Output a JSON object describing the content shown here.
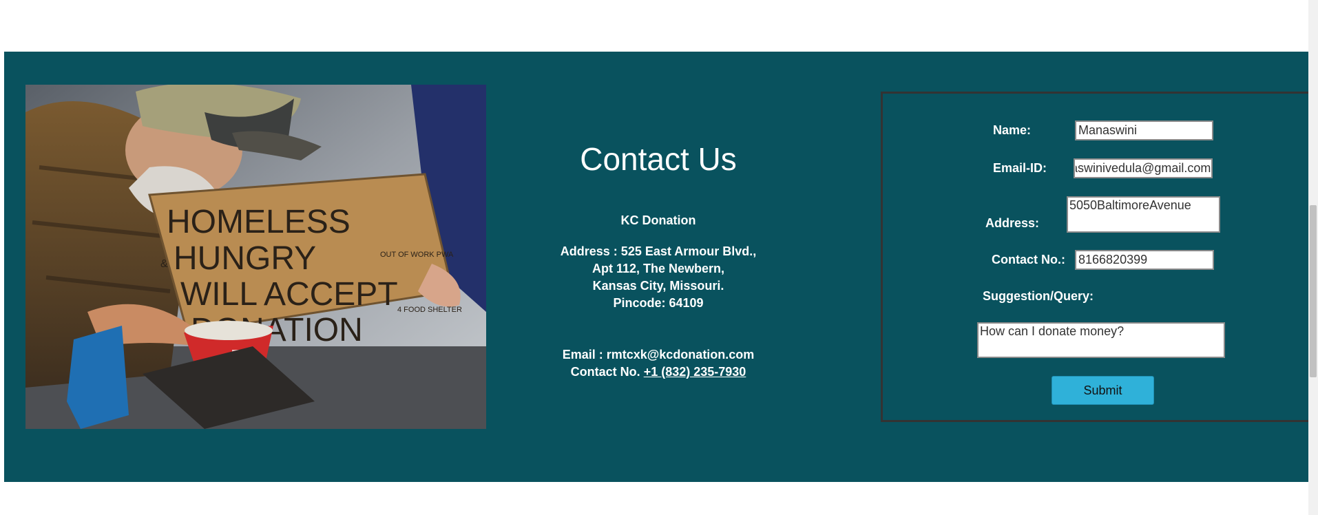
{
  "photo": {
    "alt": "Homeless man holding a cardboard sign asking for donations",
    "sign_lines": [
      "HOMELESS",
      "HUNGRY",
      "WILL ACCEPT",
      "DONATION"
    ],
    "sign_small_1": "OUT OF WORK PWA",
    "sign_small_2": "4 FOOD SHELTER",
    "sign_and": "&"
  },
  "contact": {
    "title": "Contact Us",
    "org_name": "KC Donation",
    "address_lines": [
      "Address : 525 East Armour Blvd.,",
      "Apt 112, The Newbern,",
      "Kansas City, Missouri.",
      "Pincode: 64109"
    ],
    "email_line": "Email : rmtcxk@kcdonation.com",
    "phone_prefix": "Contact No.",
    "phone_link": "+1 (832) 235-7930"
  },
  "form": {
    "name_label": "Name:",
    "name_value": "Manaswini",
    "email_label": "Email-ID:",
    "email_value": "manaswinivedula@gmail.com",
    "address_label": "Address:",
    "address_value": "5050BaltimoreAvenue",
    "contact_label": "Contact No.:",
    "contact_value": "8166820399",
    "query_label": "Suggestion/Query:",
    "query_value": "How can I donate money?",
    "submit_label": "Submit"
  },
  "colors": {
    "band": "#09525e",
    "submit": "#2fb1d9",
    "form_border": "#333333"
  }
}
